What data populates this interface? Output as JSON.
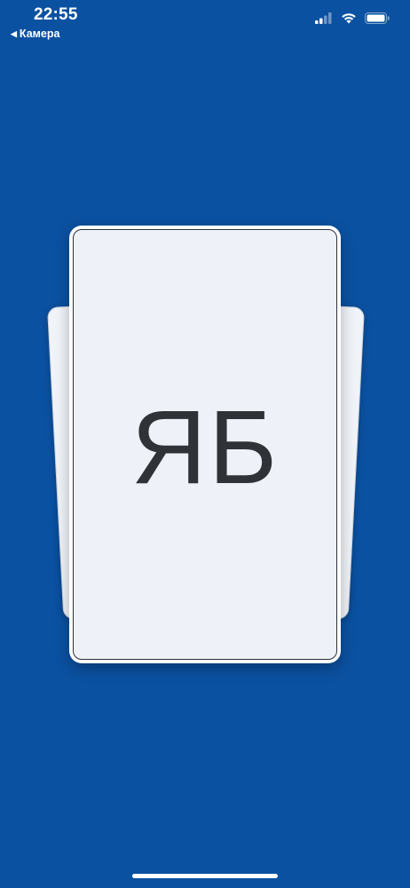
{
  "status_bar": {
    "time": "22:55",
    "back_label": "Камера",
    "icons": [
      "cellular-signal-icon",
      "wifi-icon",
      "battery-icon"
    ]
  },
  "card": {
    "monogram": "ЯБ"
  },
  "colors": {
    "background": "#0b51a1",
    "card_face": "#eef1f7",
    "monogram": "#2f3338"
  }
}
